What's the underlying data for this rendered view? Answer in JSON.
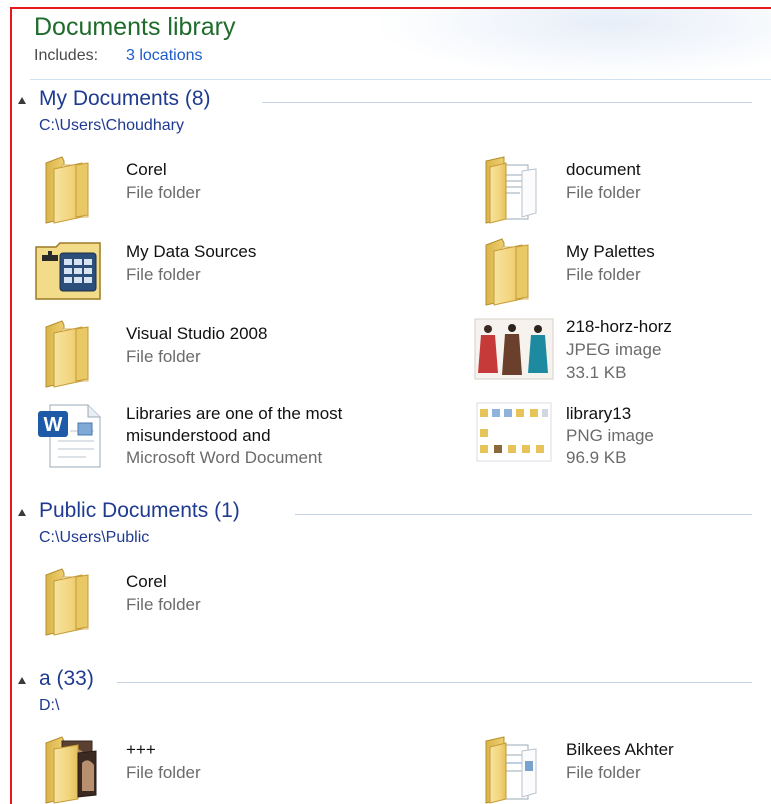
{
  "header": {
    "title": "Documents library",
    "includes_label": "Includes:",
    "includes_link": "3 locations"
  },
  "groups": [
    {
      "title": "My Documents (8)",
      "path": "C:\\Users\\Choudhary",
      "items": [
        {
          "name": "Corel",
          "type": "File folder",
          "icon": "folder-icon"
        },
        {
          "name": "document",
          "type": "File folder",
          "icon": "folder-document-icon"
        },
        {
          "name": "My Data Sources",
          "type": "File folder",
          "icon": "data-sources-folder-icon"
        },
        {
          "name": "My Palettes",
          "type": "File folder",
          "icon": "folder-icon"
        },
        {
          "name": "Visual Studio 2008",
          "type": "File folder",
          "icon": "folder-icon"
        },
        {
          "name": "218-horz-horz",
          "type": "JPEG image",
          "size": "33.1 KB",
          "icon": "jpeg-thumbnail-icon"
        },
        {
          "name": "Libraries are one of the most",
          "name2": "misunderstood and",
          "type": "Microsoft Word Document",
          "icon": "word-document-icon"
        },
        {
          "name": "library13",
          "type": "PNG image",
          "size": "96.9 KB",
          "icon": "png-thumbnail-icon"
        }
      ]
    },
    {
      "title": "Public Documents (1)",
      "path": "C:\\Users\\Public",
      "items": [
        {
          "name": "Corel",
          "type": "File folder",
          "icon": "folder-icon"
        }
      ]
    },
    {
      "title": "a (33)",
      "path": "D:\\",
      "items": [
        {
          "name": "+++",
          "type": "File folder",
          "icon": "folder-photo-icon"
        },
        {
          "name": "Bilkees Akhter",
          "type": "File folder",
          "icon": "folder-document-icon"
        }
      ]
    }
  ],
  "colors": {
    "title_green": "#1e6b2c",
    "group_blue": "#1f3a91",
    "link_blue": "#1c5bc8",
    "frame_red": "#e8191e",
    "folder_yellow": "#f1d47a"
  }
}
